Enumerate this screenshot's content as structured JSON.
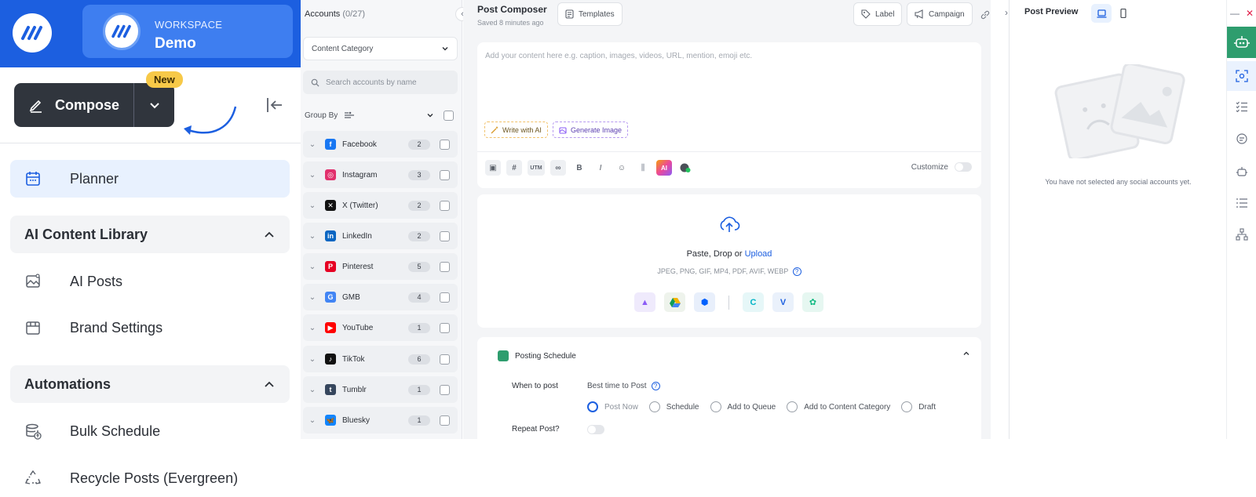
{
  "sidebar": {
    "workspace_label": "WORKSPACE",
    "workspace_name": "Demo",
    "compose_label": "Compose",
    "new_badge": "New",
    "planner_label": "Planner",
    "ai_library": {
      "label": "AI Content Library",
      "items": [
        {
          "label": "AI Posts"
        },
        {
          "label": "Brand Settings"
        }
      ]
    },
    "automations": {
      "label": "Automations",
      "items": [
        {
          "label": "Bulk Schedule"
        },
        {
          "label": "Recycle Posts (Evergreen)"
        }
      ]
    }
  },
  "accounts": {
    "title": "Accounts",
    "count": "(0/27)",
    "content_category_placeholder": "Content Category",
    "search_placeholder": "Search accounts by name",
    "group_by_label": "Group By",
    "platforms": [
      {
        "name": "Facebook",
        "count": "2",
        "color": "#1877f2",
        "glyph": "f"
      },
      {
        "name": "Instagram",
        "count": "3",
        "color": "#e1306c",
        "glyph": "◎"
      },
      {
        "name": "X (Twitter)",
        "count": "2",
        "color": "#111111",
        "glyph": "✕"
      },
      {
        "name": "LinkedIn",
        "count": "2",
        "color": "#0a66c2",
        "glyph": "in"
      },
      {
        "name": "Pinterest",
        "count": "5",
        "color": "#e60023",
        "glyph": "P"
      },
      {
        "name": "GMB",
        "count": "4",
        "color": "#4285f4",
        "glyph": "G"
      },
      {
        "name": "YouTube",
        "count": "1",
        "color": "#ff0000",
        "glyph": "▶"
      },
      {
        "name": "TikTok",
        "count": "6",
        "color": "#111111",
        "glyph": "♪"
      },
      {
        "name": "Tumblr",
        "count": "1",
        "color": "#36465d",
        "glyph": "t"
      },
      {
        "name": "Bluesky",
        "count": "1",
        "color": "#1185fe",
        "glyph": "🦋"
      }
    ]
  },
  "composer": {
    "title": "Post Composer",
    "saved": "Saved 8 minutes ago",
    "templates_label": "Templates",
    "label_btn": "Label",
    "campaign_btn": "Campaign",
    "editor_placeholder": "Add your content here e.g. caption, images, videos, URL, mention, emoji etc.",
    "write_ai_label": "Write with AI",
    "generate_image_label": "Generate Image",
    "customize_label": "Customize",
    "upload": {
      "text_prefix": "Paste, Drop or",
      "upload_link": "Upload",
      "formats": "JPEG, PNG, GIF, MP4, PDF, AVIF, WEBP"
    },
    "schedule": {
      "title": "Posting Schedule",
      "when_label": "When to post",
      "best_time_label": "Best time to Post",
      "options": [
        "Post Now",
        "Schedule",
        "Add to Queue",
        "Add to Content Category",
        "Draft"
      ],
      "selected_option": "Post Now",
      "repeat_label": "Repeat Post?"
    }
  },
  "preview": {
    "title": "Post Preview",
    "empty_message": "You have not selected any social accounts yet."
  },
  "colors": {
    "brand": "#1c5fe0",
    "brand_light": "#3e7ef0",
    "compose_bg": "#30353d",
    "badge": "#f7c948",
    "ai_green": "#2e9d6e"
  }
}
